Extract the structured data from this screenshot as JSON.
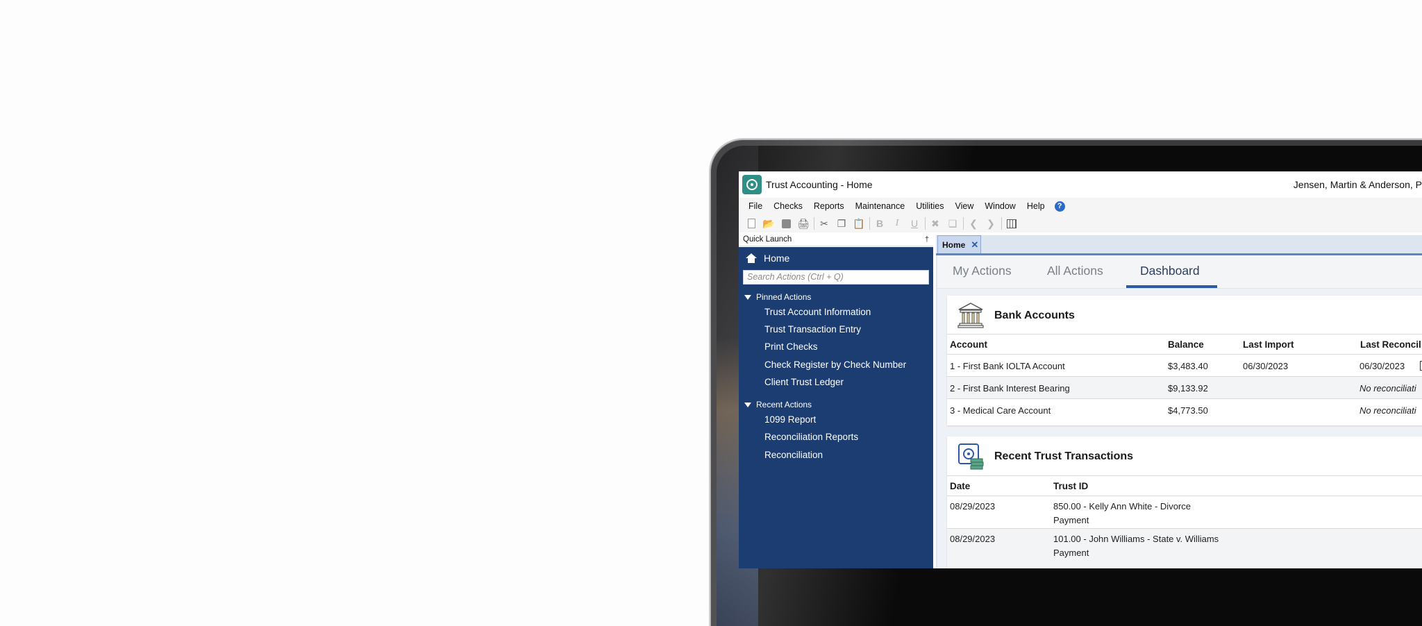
{
  "app": {
    "title": "Trust Accounting - Home",
    "firm": "Jensen, Martin & Anderson, P"
  },
  "menu": [
    "File",
    "Checks",
    "Reports",
    "Maintenance",
    "Utilities",
    "View",
    "Window",
    "Help"
  ],
  "quick_launch": {
    "header": "Quick Launch",
    "home": "Home",
    "search_placeholder": "Search Actions (Ctrl + Q)",
    "pinned_label": "Pinned Actions",
    "pinned": [
      "Trust Account Information",
      "Trust Transaction Entry",
      "Print Checks",
      "Check Register by Check Number",
      "Client Trust Ledger"
    ],
    "recent_label": "Recent Actions",
    "recent": [
      "1099 Report",
      "Reconciliation Reports",
      "Reconciliation"
    ]
  },
  "doc_tab": {
    "label": "Home",
    "close": "✕"
  },
  "view_tabs": [
    "My Actions",
    "All Actions",
    "Dashboard"
  ],
  "bank_accounts": {
    "title": "Bank Accounts",
    "columns": [
      "Account",
      "Balance",
      "Last Import",
      "Last Reconcil"
    ],
    "rows": [
      {
        "account": "1 - First Bank IOLTA Account",
        "balance": "$3,483.40",
        "last_import": "06/30/2023",
        "last_reconciliation": "06/30/2023"
      },
      {
        "account": "2 - First Bank Interest Bearing",
        "balance": "$9,133.92",
        "last_import": "",
        "last_reconciliation": "No reconciliati"
      },
      {
        "account": "3 - Medical Care Account",
        "balance": "$4,773.50",
        "last_import": "",
        "last_reconciliation": "No reconciliati"
      }
    ]
  },
  "recent_transactions": {
    "title": "Recent Trust Transactions",
    "columns": [
      "Date",
      "Trust ID"
    ],
    "rows": [
      {
        "date": "08/29/2023",
        "line1": "850.00 - Kelly Ann White - Divorce",
        "line2": "Payment"
      },
      {
        "date": "08/29/2023",
        "line1": "101.00 - John Williams - State v. Williams",
        "line2": "Payment"
      }
    ]
  }
}
